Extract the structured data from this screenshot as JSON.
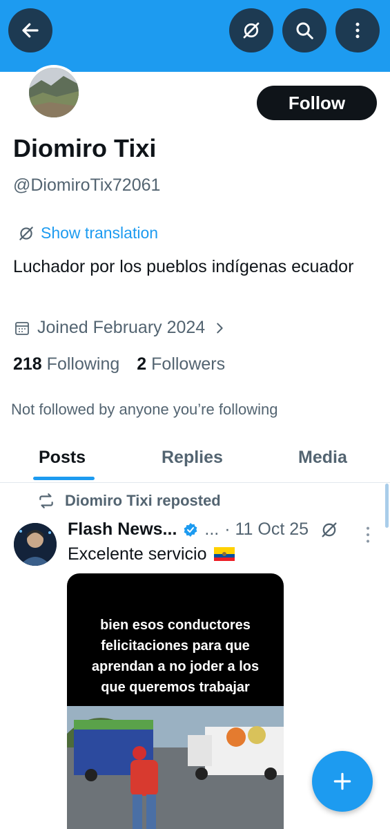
{
  "topbar": {
    "back_icon": "arrow-left-icon",
    "translate_icon": "translate-icon",
    "search_icon": "search-icon",
    "more_icon": "more-vertical-icon"
  },
  "profile": {
    "follow_label": "Follow",
    "name": "Diomiro Tixi",
    "handle": "@DiomiroTix72061",
    "show_translation": "Show translation",
    "bio": "Luchador por los pueblos indígenas ecuador",
    "joined": "Joined February 2024",
    "following_count": "218",
    "following_label": "Following",
    "followers_count": "2",
    "followers_label": "Followers",
    "not_followed": "Not followed by anyone you’re following"
  },
  "tabs": [
    {
      "label": "Posts",
      "active": true
    },
    {
      "label": "Replies",
      "active": false
    },
    {
      "label": "Media",
      "active": false
    }
  ],
  "post": {
    "repost_label": "Diomiro Tixi reposted",
    "author": "Flash News...",
    "ellipsis": "...",
    "date": "· 11 Oct 25",
    "text": "Excelente servicio",
    "media_caption": [
      "bien esos conductores",
      "felicitaciones para que",
      "aprendan a no joder a los",
      "que queremos trabajar"
    ]
  },
  "colors": {
    "accent": "#1d9bf0",
    "banner": "#1d9bf0",
    "button_dark": "#1d3a52",
    "text_secondary": "#536471"
  }
}
